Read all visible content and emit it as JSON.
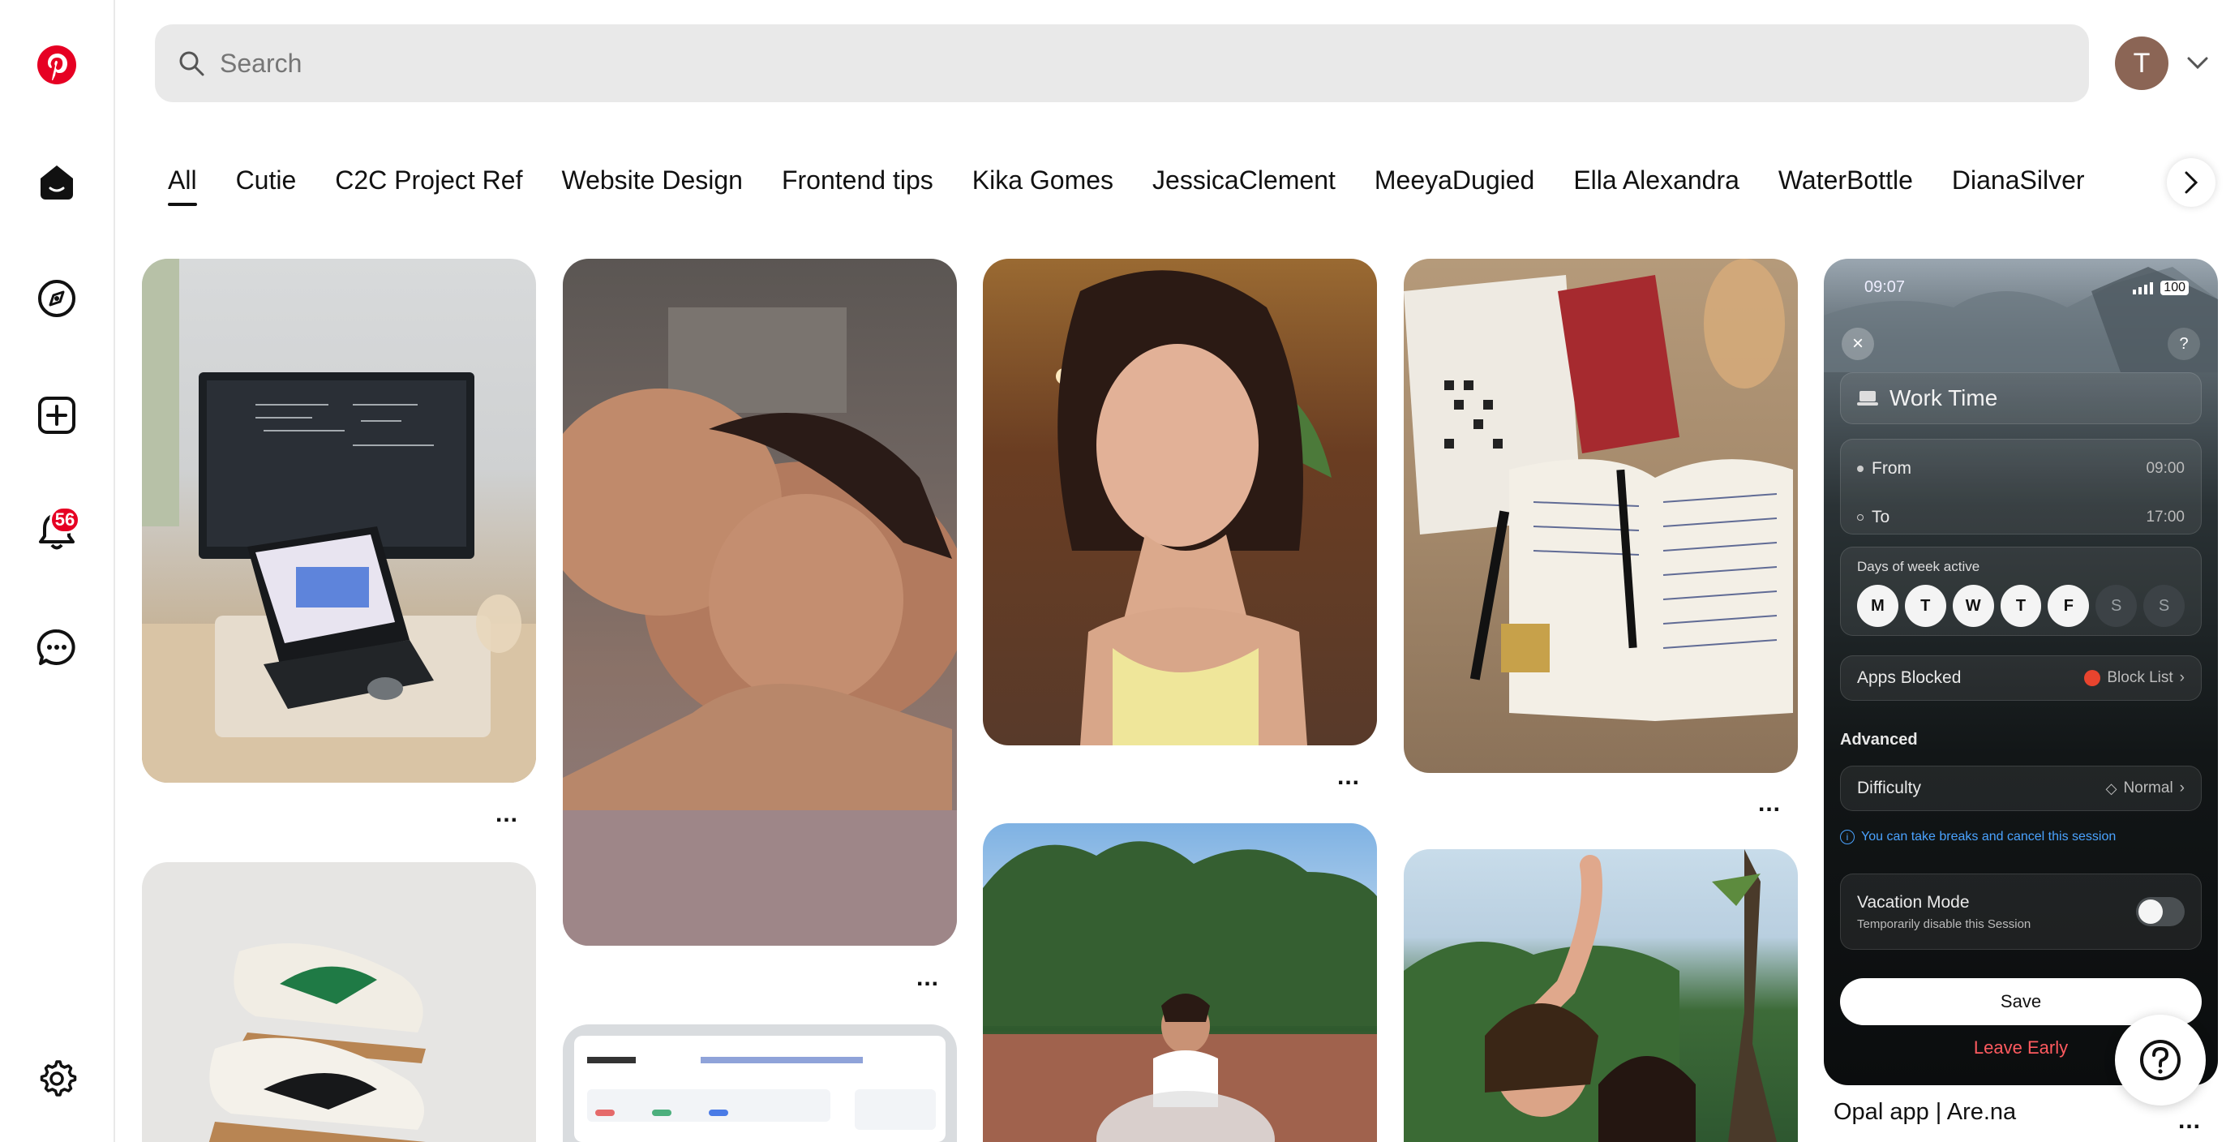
{
  "sidebar": {
    "items": [
      {
        "name": "pinterest-logo-icon"
      },
      {
        "name": "home-icon"
      },
      {
        "name": "explore-icon"
      },
      {
        "name": "create-icon"
      },
      {
        "name": "notifications-icon",
        "badge": "56"
      },
      {
        "name": "messages-icon"
      },
      {
        "name": "settings-icon"
      }
    ]
  },
  "header": {
    "search_placeholder": "Search",
    "avatar_initial": "T"
  },
  "tabs": [
    "All",
    "Cutie",
    "C2C Project Ref",
    "Website Design",
    "Frontend tips",
    "Kika Gomes",
    "JessicaClement",
    "MeeyaDugied",
    "Ella Alexandra",
    "WaterBottle",
    "DianaSilver"
  ],
  "active_tab": "All",
  "more_label": "...",
  "opal_pin": {
    "status_time": "09:07",
    "status_battery": "100",
    "title": "Work Time",
    "from_label": "From",
    "from_value": "09:00",
    "to_label": "To",
    "to_value": "17:00",
    "days_label": "Days of week active",
    "days": [
      "M",
      "T",
      "W",
      "T",
      "F",
      "S",
      "S"
    ],
    "apps_label": "Apps Blocked",
    "apps_value": "Block List",
    "advanced_label": "Advanced",
    "difficulty_label": "Difficulty",
    "difficulty_value": "Normal",
    "breaks_note": "You can take breaks and cancel this session",
    "vacation_label": "Vacation Mode",
    "vacation_sub": "Temporarily disable this Session",
    "save_label": "Save",
    "leave_label": "Leave Early",
    "pin_title": "Opal app | Are.na"
  },
  "colors": {
    "brand": "#e60023",
    "search_bg": "#e9e9e9",
    "avatar_bg": "#8b6555",
    "leave_red": "#ff5a5f"
  }
}
